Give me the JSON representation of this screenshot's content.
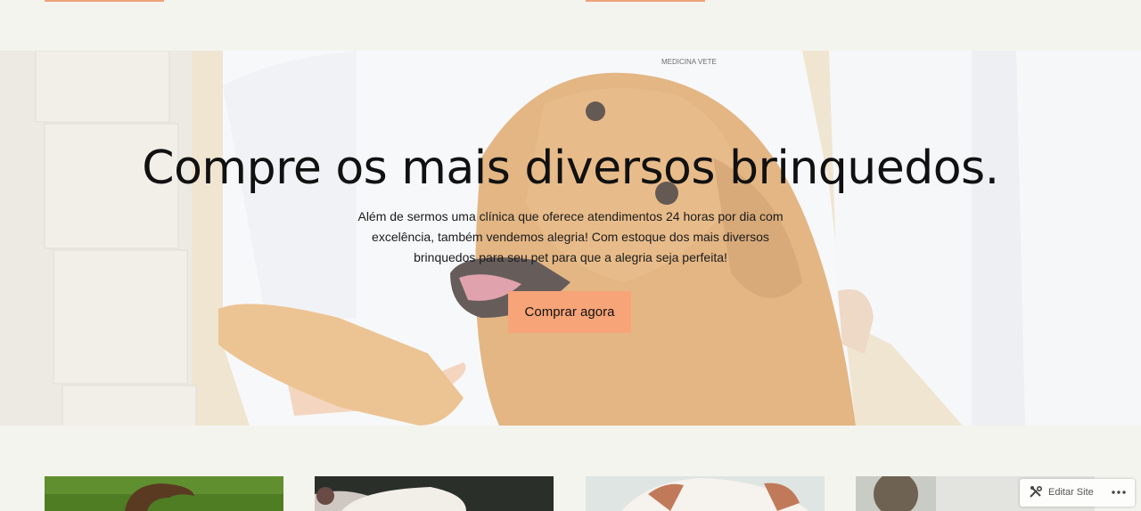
{
  "hero": {
    "title": "Compre os mais diversos brinquedos.",
    "text": "Além de sermos uma clínica que oferece atendimentos 24 horas por dia com excelência, também vendemos alegria! Com estoque dos mais diversos brinquedos para seu pet para que a alegria seja perfeita!",
    "button_label": "Comprar agora",
    "background_image": "dog-at-vet-photo"
  },
  "cards": [
    {
      "image": "dog-on-grass-photo"
    },
    {
      "image": "puppy-photo"
    },
    {
      "image": "white-puppy-photo"
    },
    {
      "image": "dog-photo"
    }
  ],
  "admin_bar": {
    "edit_label": "Editar Site",
    "edit_icon": "tools-icon",
    "more_icon": "more-icon"
  },
  "colors": {
    "accent": "#f6a478",
    "page_background": "#f4f4ee"
  }
}
